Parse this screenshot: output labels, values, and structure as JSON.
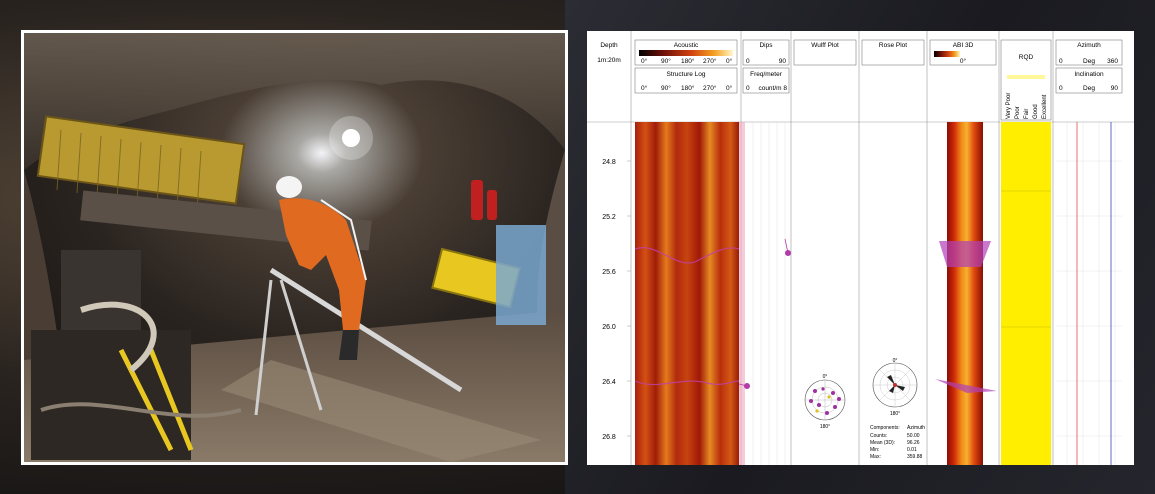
{
  "log": {
    "headers": {
      "depth": "Depth",
      "depth_scale": "1m:20m",
      "acoustic": "Acoustic",
      "acoustic_ticks": [
        "0°",
        "90°",
        "180°",
        "270°",
        "0°"
      ],
      "structure_log": "Structure Log",
      "structure_ticks": [
        "0°",
        "90°",
        "180°",
        "270°",
        "0°"
      ],
      "dips": "Dips",
      "dips_range_min": "0",
      "dips_range_max": "90",
      "freq": "Freq/meter",
      "freq_range_min": "0",
      "freq_range_max": "count/m  8",
      "wulff": "Wulff Plot",
      "rose": "Rose Plot",
      "abi3d": "ABI 3D",
      "abi3d_tick": "0°",
      "rqd": "RQD",
      "rqd_classes": [
        "Very Poor",
        "Poor",
        "Fair",
        "Good",
        "Excellent"
      ],
      "azimuth": "Azimuth",
      "az_min": "0",
      "az_unit": "Deg",
      "az_max": "360",
      "inclination": "Inclination",
      "inc_min": "0",
      "inc_unit": "Deg",
      "inc_max": "90"
    },
    "depths": [
      "24.8",
      "25.2",
      "25.6",
      "26.0",
      "26.4",
      "26.8"
    ],
    "wulff_labels": {
      "top": "0°",
      "bottom": "180°"
    },
    "rose_labels": {
      "top": "0°",
      "bottom": "180°"
    },
    "stats": {
      "title_left": "Components:",
      "title_right": "Azimuth",
      "rows": [
        {
          "k": "Counts:",
          "v": "50.00"
        },
        {
          "k": "Mean (3D):",
          "v": "96.26"
        },
        {
          "k": "Min:",
          "v": "0.01"
        },
        {
          "k": "Max:",
          "v": "359.88"
        }
      ]
    }
  },
  "colors": {
    "abi_dark": "#a0140a",
    "abi_mid": "#e04010",
    "abi_light": "#f2a020",
    "rqd_fill": "#ffee00",
    "dip_marker": "#b03ca8"
  }
}
